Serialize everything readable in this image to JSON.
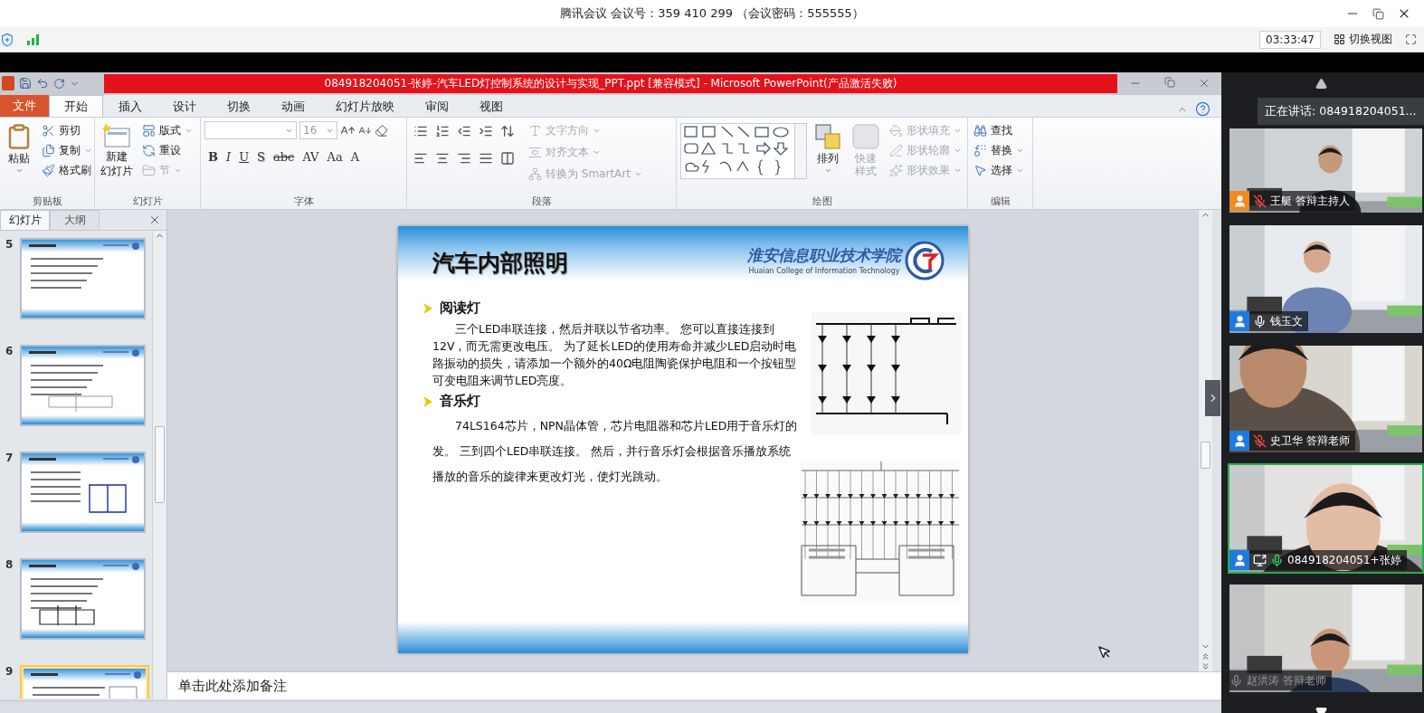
{
  "meeting": {
    "title": "腾讯会议 会议号：359 410 299 （会议密码：555555）",
    "time": "03:33:47",
    "view_button": "切换视图"
  },
  "powerpoint": {
    "title": "084918204051-张婷-汽车LED灯控制系统的设计与实现_PPT.ppt [兼容模式]  -  Microsoft PowerPoint(产品激活失败)",
    "file_tab": "文件",
    "tabs": [
      {
        "label": "开始",
        "selected": true
      },
      {
        "label": "插入",
        "selected": false
      },
      {
        "label": "设计",
        "selected": false
      },
      {
        "label": "切换",
        "selected": false
      },
      {
        "label": "动画",
        "selected": false
      },
      {
        "label": "幻灯片放映",
        "selected": false
      },
      {
        "label": "审阅",
        "selected": false
      },
      {
        "label": "视图",
        "selected": false
      }
    ],
    "ribbon": {
      "clipboard": {
        "label": "剪贴板",
        "paste": "粘贴",
        "commands": [
          {
            "kind": "cut",
            "label": "剪切"
          },
          {
            "kind": "copy",
            "label": "复制"
          },
          {
            "kind": "painter",
            "label": "格式刷"
          }
        ]
      },
      "slides": {
        "label": "幻灯片",
        "new_slide": "新建",
        "new_slide_line2": "幻灯片",
        "commands": [
          {
            "kind": "layout",
            "label": "版式",
            "disabled": false
          },
          {
            "kind": "reset",
            "label": "重设",
            "disabled": false
          },
          {
            "kind": "section",
            "label": "节",
            "disabled": true
          }
        ]
      },
      "font": {
        "label": "字体",
        "font_size": "16",
        "format_buttons": [
          {
            "kind": "bold",
            "label": "B"
          },
          {
            "kind": "italic",
            "label": "I"
          },
          {
            "kind": "underline",
            "label": "U"
          },
          {
            "kind": "shadow",
            "label": "S"
          },
          {
            "kind": "strike",
            "label": "abc"
          },
          {
            "kind": "spacing",
            "label": "AV"
          },
          {
            "kind": "case",
            "label": "Aa"
          },
          {
            "kind": "color",
            "label": "A"
          }
        ]
      },
      "paragraph": {
        "label": "段落",
        "commands": [
          {
            "kind": "direction",
            "label": "文字方向",
            "disabled": true
          },
          {
            "kind": "align",
            "label": "对齐文本",
            "disabled": true
          },
          {
            "kind": "smartart",
            "label": "转换为 SmartArt",
            "disabled": true
          }
        ]
      },
      "drawing": {
        "label": "绘图",
        "arrange": "排列",
        "quick_styles": {
          "label": "快速样式",
          "disabled": true
        },
        "commands": [
          {
            "kind": "fill",
            "label": "形状填充",
            "disabled": true
          },
          {
            "kind": "outline",
            "label": "形状轮廓",
            "disabled": true
          },
          {
            "kind": "effects",
            "label": "形状效果",
            "disabled": true
          }
        ]
      },
      "editing": {
        "label": "编辑",
        "commands": [
          {
            "kind": "find",
            "label": "查找"
          },
          {
            "kind": "replace",
            "label": "替换"
          },
          {
            "kind": "select",
            "label": "选择"
          }
        ]
      }
    },
    "pane_tabs": [
      {
        "label": "幻灯片",
        "selected": true
      },
      {
        "label": "大纲",
        "selected": false
      }
    ],
    "thumbnails": [
      {
        "number": "5",
        "selected": false
      },
      {
        "number": "6",
        "selected": false
      },
      {
        "number": "7",
        "selected": false
      },
      {
        "number": "8",
        "selected": false
      },
      {
        "number": "9",
        "selected": true
      }
    ],
    "slide": {
      "title": "汽车内部照明",
      "logo_text": "淮安信息职业技术学院",
      "logo_subtitle": "Huaian College of Information Technology",
      "sections": [
        {
          "heading": "阅读灯",
          "body": "三个LED串联连接，然后并联以节省功率。  您可以直接连接到12V，而无需更改电压。 为了延长LED的使用寿命并减少LED启动时电路振动的损失，请添加一个额外的40Ω电阻陶瓷保护电阻和一个按钮型可变电阻来调节LED亮度。"
        },
        {
          "heading": "音乐灯",
          "body": "74LS164芯片，NPN晶体管，芯片电阻器和芯片LED用于音乐灯的发。 三到四个LED串联连接。 然后，并行音乐灯会根据音乐播放系统播放的音乐的旋律来更改灯光，使灯光跳动。"
        }
      ]
    },
    "notes": {
      "placeholder": "单击此处添加备注"
    }
  },
  "speaker_tip": "正在讲话: 084918204051...",
  "participants": [
    {
      "name": "王艇 答辩主持人",
      "host": true,
      "muted": true,
      "speaking": false,
      "sharing": false,
      "dimmed": false
    },
    {
      "name": "钱玉文",
      "host": false,
      "muted": false,
      "speaking": false,
      "sharing": false,
      "dimmed": false
    },
    {
      "name": "史卫华 答辩老师",
      "host": false,
      "muted": true,
      "speaking": false,
      "sharing": false,
      "dimmed": false
    },
    {
      "name": "084918204051+张婷",
      "host": false,
      "muted": false,
      "speaking": true,
      "sharing": true,
      "dimmed": false
    },
    {
      "name": "赵洪涛 答辩老师",
      "muted": false,
      "speaking": false,
      "sharing": false,
      "dimmed": true
    }
  ]
}
